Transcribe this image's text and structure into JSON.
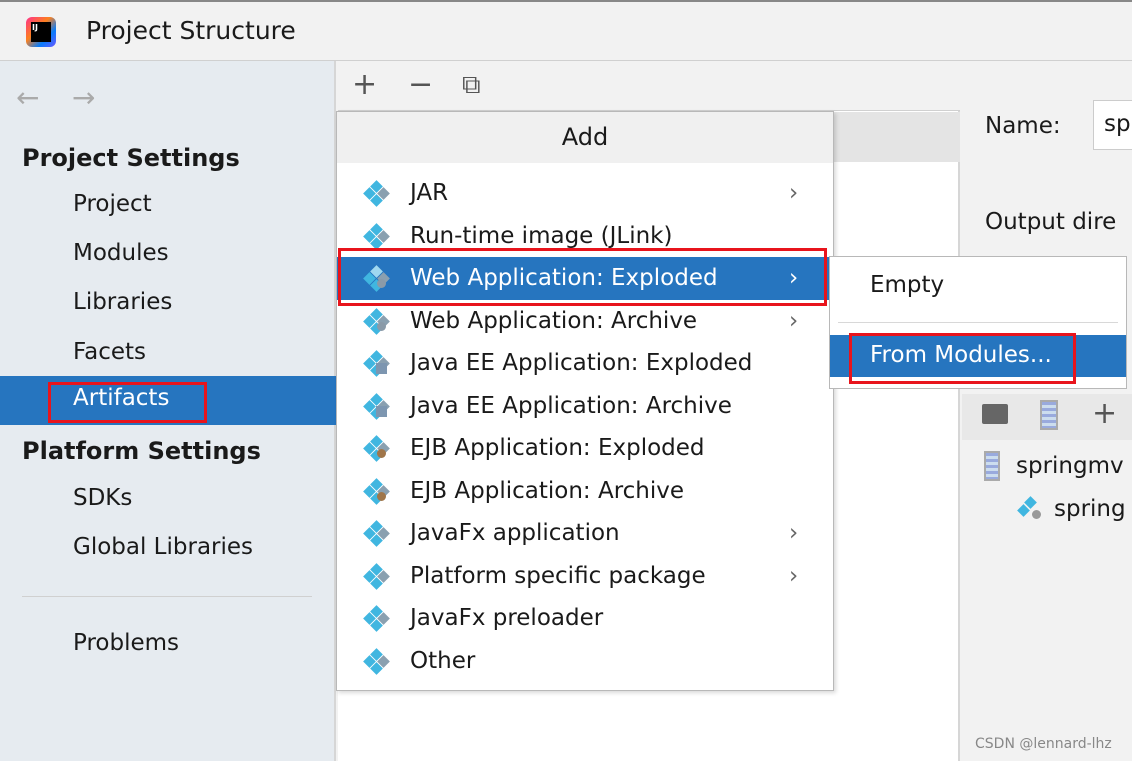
{
  "window": {
    "title": "Project Structure"
  },
  "sidebar": {
    "back": "←",
    "forward": "→",
    "project_settings": "Project Settings",
    "items": [
      "Project",
      "Modules",
      "Libraries",
      "Facets",
      "Artifacts"
    ],
    "platform_settings": "Platform Settings",
    "platform_items": [
      "SDKs",
      "Global Libraries"
    ],
    "problems": "Problems",
    "selected": "Artifacts"
  },
  "toolbar": {
    "add": "+",
    "remove": "−",
    "copy": "⧉"
  },
  "menu": {
    "header": "Add",
    "items": [
      {
        "label": "JAR",
        "arrow": true,
        "icon": "artifact-icon"
      },
      {
        "label": "Run-time image (JLink)",
        "arrow": false,
        "icon": "artifact-icon"
      },
      {
        "label": "Web Application: Exploded",
        "arrow": true,
        "icon": "web-artifact-icon",
        "highlighted": true
      },
      {
        "label": "Web Application: Archive",
        "arrow": true,
        "icon": "web-artifact-icon"
      },
      {
        "label": "Java EE Application: Exploded",
        "arrow": false,
        "icon": "javaee-artifact-icon"
      },
      {
        "label": "Java EE Application: Archive",
        "arrow": false,
        "icon": "javaee-artifact-icon"
      },
      {
        "label": "EJB Application: Exploded",
        "arrow": false,
        "icon": "ejb-artifact-icon"
      },
      {
        "label": "EJB Application: Archive",
        "arrow": false,
        "icon": "ejb-artifact-icon"
      },
      {
        "label": "JavaFx application",
        "arrow": true,
        "icon": "artifact-icon"
      },
      {
        "label": "Platform specific package",
        "arrow": true,
        "icon": "artifact-icon"
      },
      {
        "label": "JavaFx preloader",
        "arrow": false,
        "icon": "artifact-icon"
      },
      {
        "label": "Other",
        "arrow": false,
        "icon": "artifact-icon"
      }
    ]
  },
  "submenu": {
    "items": [
      "Empty",
      "From Modules..."
    ],
    "highlighted": "From Modules..."
  },
  "right": {
    "name_label": "Name:",
    "name_value": "sp",
    "output_label": "Output dire",
    "tree": [
      "springmv",
      "spring"
    ]
  },
  "watermark": "CSDN @lennard-lhz",
  "colors": {
    "selection": "#2675bf",
    "highlight_box": "#e8141c",
    "sidebar_bg": "#e6ebf0"
  }
}
